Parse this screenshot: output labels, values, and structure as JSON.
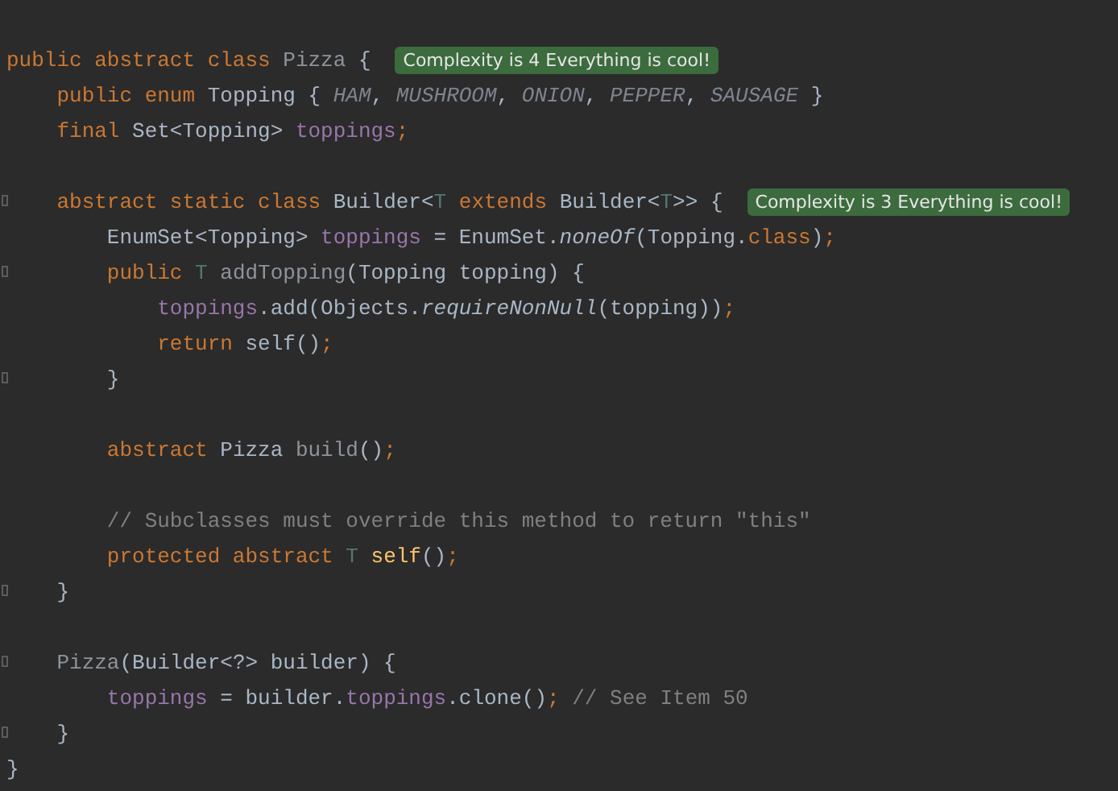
{
  "editor": {
    "lines": [
      {
        "fold": false,
        "tokens": [
          {
            "kind": "keyword",
            "text": "public abstract class "
          },
          {
            "kind": "unused",
            "text": "Pizza"
          },
          {
            "kind": "plain",
            "text": " {"
          }
        ],
        "badge": "Complexity is 4 Everything is cool!"
      },
      {
        "fold": false,
        "tokens": [
          {
            "kind": "keyword",
            "text": "    public enum "
          },
          {
            "kind": "plain",
            "text": "Topping { "
          },
          {
            "kind": "constant",
            "text": "HAM"
          },
          {
            "kind": "plain",
            "text": ", "
          },
          {
            "kind": "constant",
            "text": "MUSHROOM"
          },
          {
            "kind": "plain",
            "text": ", "
          },
          {
            "kind": "constant",
            "text": "ONION"
          },
          {
            "kind": "plain",
            "text": ", "
          },
          {
            "kind": "constant",
            "text": "PEPPER"
          },
          {
            "kind": "plain",
            "text": ", "
          },
          {
            "kind": "constant",
            "text": "SAUSAGE"
          },
          {
            "kind": "plain",
            "text": " }"
          }
        ]
      },
      {
        "fold": false,
        "tokens": [
          {
            "kind": "keyword",
            "text": "    final "
          },
          {
            "kind": "plain",
            "text": "Set<Topping> "
          },
          {
            "kind": "field",
            "text": "toppings"
          },
          {
            "kind": "keyword",
            "text": ";"
          }
        ]
      },
      {
        "fold": false
      },
      {
        "fold": true,
        "tokens": [
          {
            "kind": "keyword",
            "text": "    abstract static class "
          },
          {
            "kind": "plain",
            "text": "Builder<"
          },
          {
            "kind": "typeparam",
            "text": "T"
          },
          {
            "kind": "keyword",
            "text": " extends "
          },
          {
            "kind": "plain",
            "text": "Builder<"
          },
          {
            "kind": "typeparam",
            "text": "T"
          },
          {
            "kind": "plain",
            "text": ">> {"
          }
        ],
        "badge": "Complexity is 3 Everything is cool!"
      },
      {
        "fold": false,
        "tokens": [
          {
            "kind": "plain",
            "text": "        EnumSet<Topping> "
          },
          {
            "kind": "field",
            "text": "toppings"
          },
          {
            "kind": "plain",
            "text": " = EnumSet."
          },
          {
            "kind": "italic",
            "text": "noneOf"
          },
          {
            "kind": "plain",
            "text": "(Topping."
          },
          {
            "kind": "keyword",
            "text": "class"
          },
          {
            "kind": "plain",
            "text": ")"
          },
          {
            "kind": "keyword",
            "text": ";"
          }
        ]
      },
      {
        "fold": true,
        "tokens": [
          {
            "kind": "keyword",
            "text": "        public "
          },
          {
            "kind": "typeparam",
            "text": "T "
          },
          {
            "kind": "unused",
            "text": "addTopping"
          },
          {
            "kind": "plain",
            "text": "(Topping topping) {"
          }
        ]
      },
      {
        "fold": false,
        "tokens": [
          {
            "kind": "field",
            "text": "            toppings"
          },
          {
            "kind": "plain",
            "text": ".add(Objects."
          },
          {
            "kind": "italic",
            "text": "requireNonNull"
          },
          {
            "kind": "plain",
            "text": "(topping))"
          },
          {
            "kind": "keyword",
            "text": ";"
          }
        ]
      },
      {
        "fold": false,
        "tokens": [
          {
            "kind": "keyword",
            "text": "            return "
          },
          {
            "kind": "plain",
            "text": "self()"
          },
          {
            "kind": "keyword",
            "text": ";"
          }
        ]
      },
      {
        "fold": true,
        "tokens": [
          {
            "kind": "plain",
            "text": "        }"
          }
        ]
      },
      {
        "fold": false
      },
      {
        "fold": false,
        "tokens": [
          {
            "kind": "keyword",
            "text": "        abstract "
          },
          {
            "kind": "plain",
            "text": "Pizza "
          },
          {
            "kind": "unused",
            "text": "build"
          },
          {
            "kind": "plain",
            "text": "()"
          },
          {
            "kind": "keyword",
            "text": ";"
          }
        ]
      },
      {
        "fold": false
      },
      {
        "fold": false,
        "tokens": [
          {
            "kind": "comment",
            "text": "        // Subclasses must override this method to return \"this\""
          }
        ]
      },
      {
        "fold": false,
        "tokens": [
          {
            "kind": "keyword",
            "text": "        protected abstract "
          },
          {
            "kind": "typeparam",
            "text": "T "
          },
          {
            "kind": "method",
            "text": "self"
          },
          {
            "kind": "plain",
            "text": "()"
          },
          {
            "kind": "keyword",
            "text": ";"
          }
        ]
      },
      {
        "fold": true,
        "tokens": [
          {
            "kind": "plain",
            "text": "    }"
          }
        ]
      },
      {
        "fold": false
      },
      {
        "fold": true,
        "tokens": [
          {
            "kind": "unused",
            "text": "    Pizza"
          },
          {
            "kind": "plain",
            "text": "(Builder<?> builder) {"
          }
        ]
      },
      {
        "fold": false,
        "tokens": [
          {
            "kind": "field",
            "text": "        toppings"
          },
          {
            "kind": "plain",
            "text": " = builder."
          },
          {
            "kind": "field",
            "text": "toppings"
          },
          {
            "kind": "plain",
            "text": ".clone()"
          },
          {
            "kind": "keyword",
            "text": ";"
          },
          {
            "kind": "comment",
            "text": " // See Item 50"
          }
        ]
      },
      {
        "fold": true,
        "tokens": [
          {
            "kind": "plain",
            "text": "    }"
          }
        ]
      },
      {
        "fold": false,
        "tokens": [
          {
            "kind": "plain",
            "text": "}"
          }
        ]
      }
    ]
  }
}
